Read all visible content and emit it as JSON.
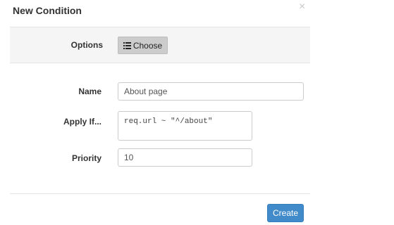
{
  "modal": {
    "title": "New Condition",
    "close_glyph": "×"
  },
  "options": {
    "label": "Options",
    "choose_label": "Choose",
    "choose_icon": "list-icon"
  },
  "form": {
    "name_label": "Name",
    "name_value": "About page",
    "apply_if_label": "Apply If...",
    "apply_if_value": "req.url ~ \"^/about\"",
    "priority_label": "Priority",
    "priority_value": "10"
  },
  "footer": {
    "create_label": "Create"
  },
  "colors": {
    "primary": "#428bca",
    "band": "#f5f5f5",
    "choose_bg": "#cccccc"
  }
}
